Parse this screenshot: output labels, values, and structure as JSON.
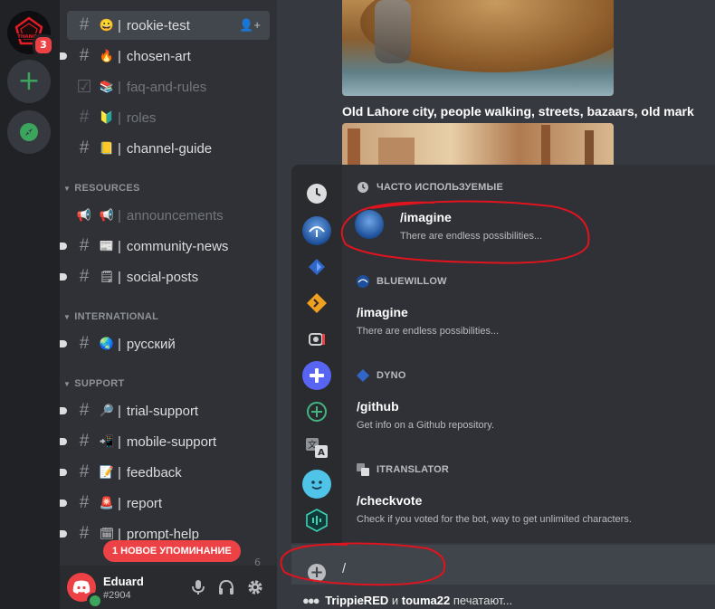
{
  "server_rail": {
    "logo_badge": "3",
    "add_label": "+"
  },
  "channels": [
    {
      "name": "rookie-test",
      "emoji": "😀",
      "active": true,
      "muted": false,
      "unread": false,
      "type": "text"
    },
    {
      "name": "chosen-art",
      "emoji": "🔥",
      "active": false,
      "muted": false,
      "unread": true,
      "type": "text"
    },
    {
      "name": "faq-and-rules",
      "emoji": "📚",
      "active": false,
      "muted": true,
      "unread": false,
      "type": "rules"
    },
    {
      "name": "roles",
      "emoji": "🔰",
      "active": false,
      "muted": true,
      "unread": false,
      "type": "text"
    },
    {
      "name": "channel-guide",
      "emoji": "📒",
      "active": false,
      "muted": false,
      "unread": false,
      "type": "text"
    },
    {
      "name": "announcements",
      "emoji": "📢",
      "active": false,
      "muted": true,
      "unread": false,
      "type": "announce"
    },
    {
      "name": "community-news",
      "emoji": "📰",
      "active": false,
      "muted": false,
      "unread": true,
      "type": "text"
    },
    {
      "name": "social-posts",
      "emoji": "🗒",
      "active": false,
      "muted": false,
      "unread": true,
      "type": "text"
    },
    {
      "name": "русский",
      "emoji": "🌏",
      "active": false,
      "muted": false,
      "unread": true,
      "type": "text"
    },
    {
      "name": "trial-support",
      "emoji": "🔎",
      "active": false,
      "muted": false,
      "unread": true,
      "type": "text"
    },
    {
      "name": "mobile-support",
      "emoji": "📲",
      "active": false,
      "muted": false,
      "unread": true,
      "type": "text"
    },
    {
      "name": "feedback",
      "emoji": "📝",
      "active": false,
      "muted": false,
      "unread": true,
      "type": "text"
    },
    {
      "name": "report",
      "emoji": "🚨",
      "active": false,
      "muted": false,
      "unread": true,
      "type": "text"
    },
    {
      "name": "prompt-help",
      "emoji": "🗓",
      "active": false,
      "muted": false,
      "unread": true,
      "type": "text"
    }
  ],
  "categories": {
    "resources": "RESOURCES",
    "international": "INTERNATIONAL",
    "support": "SUPPORT"
  },
  "mention_pill": "1 НОВОЕ УПОМИНАНИЕ",
  "hidden_count": "6",
  "user": {
    "name": "Eduard",
    "tag": "#2904"
  },
  "chat": {
    "prompt_text": "Old Lahore city, people walking, streets, bazaars, old mark"
  },
  "picker": {
    "frequent_header": "ЧАСТО ИСПОЛЬЗУЕМЫЕ",
    "frequent_cmd": {
      "name": "/imagine",
      "desc": "There are endless possibilities..."
    },
    "sections": [
      {
        "app": "BLUEWILLOW",
        "cmd": "/imagine",
        "desc": "There are endless possibilities..."
      },
      {
        "app": "DYNO",
        "cmd": "/github",
        "desc": "Get info on a Github repository."
      },
      {
        "app": "ITRANSLATOR",
        "cmd": "/checkvote",
        "desc": "Check if you voted for the bot, way to get unlimited characters."
      }
    ]
  },
  "composer": {
    "value": "/"
  },
  "typing": {
    "users": "TrippieRED",
    "conj": "и",
    "users2": "touma22",
    "suffix": "печатают..."
  },
  "colors": {
    "accent_red": "#ed4245",
    "online_green": "#3ba55d",
    "annotation_red": "#e0141e"
  }
}
